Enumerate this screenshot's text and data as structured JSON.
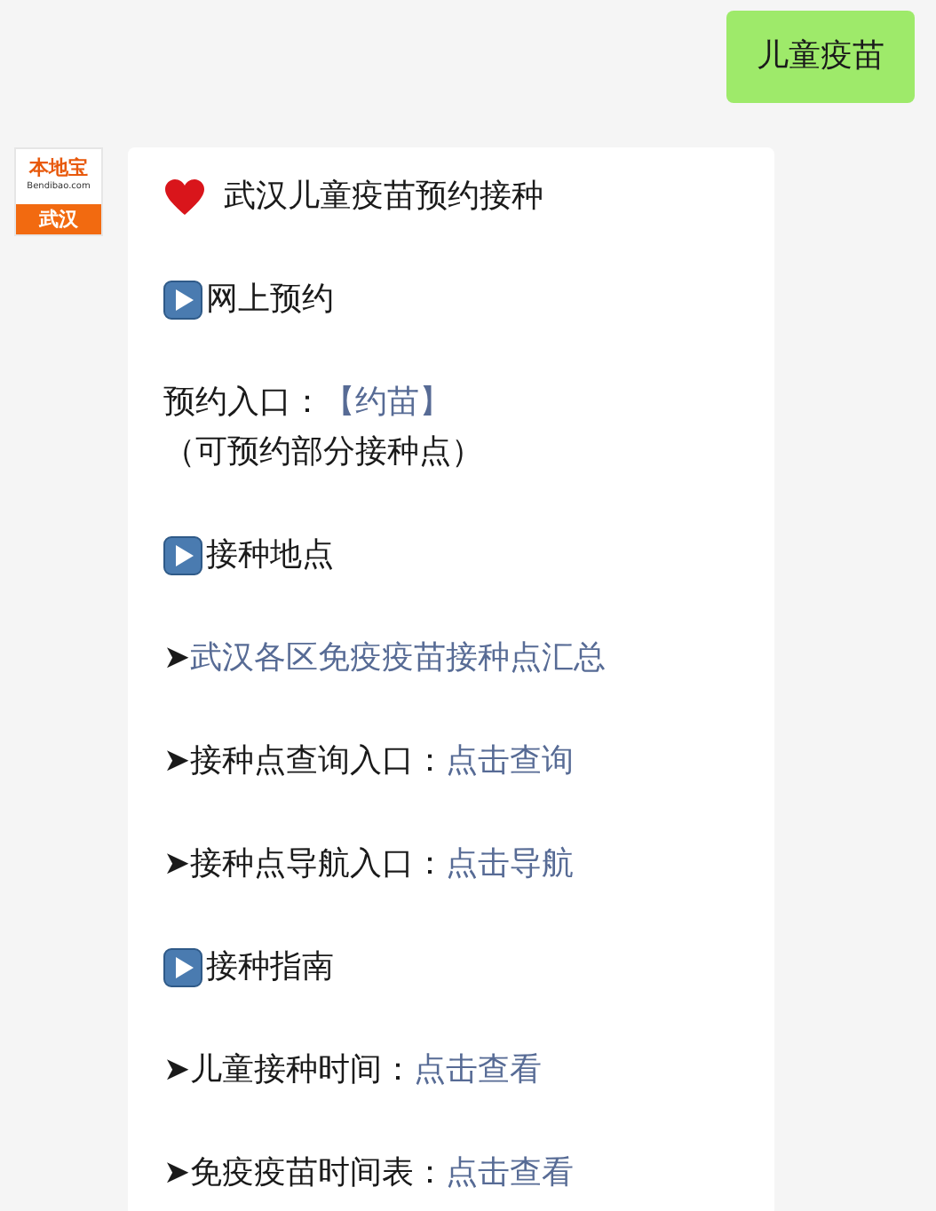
{
  "messages": [
    {
      "kind": "outgoing",
      "text": "儿童疫苗"
    },
    {
      "kind": "incoming",
      "avatar": {
        "brand": "本地宝",
        "site": "Bendibao.com",
        "city": "武汉"
      },
      "lines": [
        {
          "kind": "title",
          "text": "武汉儿童疫苗预约接种"
        },
        {
          "kind": "section",
          "text": "网上预约"
        },
        {
          "kind": "entry",
          "label": "预约入口：",
          "link": "【约苗】"
        },
        {
          "kind": "note",
          "text": "（可预约部分接种点）"
        },
        {
          "kind": "section",
          "text": "接种地点"
        },
        {
          "kind": "arrow",
          "marker": "➤",
          "link": "武汉各区免疫疫苗接种点汇总"
        },
        {
          "kind": "arrow",
          "marker": "➤",
          "label": "接种点查询入口：",
          "link": "点击查询"
        },
        {
          "kind": "arrow",
          "marker": "➤",
          "label": "接种点导航入口：",
          "link": "点击导航"
        },
        {
          "kind": "section",
          "text": "接种指南"
        },
        {
          "kind": "arrow",
          "marker": "➤",
          "label": "儿童接种时间：",
          "link": "点击查看"
        },
        {
          "kind": "arrow",
          "marker": "➤",
          "label": "免疫疫苗时间表：",
          "link": "点击查看"
        }
      ]
    }
  ]
}
